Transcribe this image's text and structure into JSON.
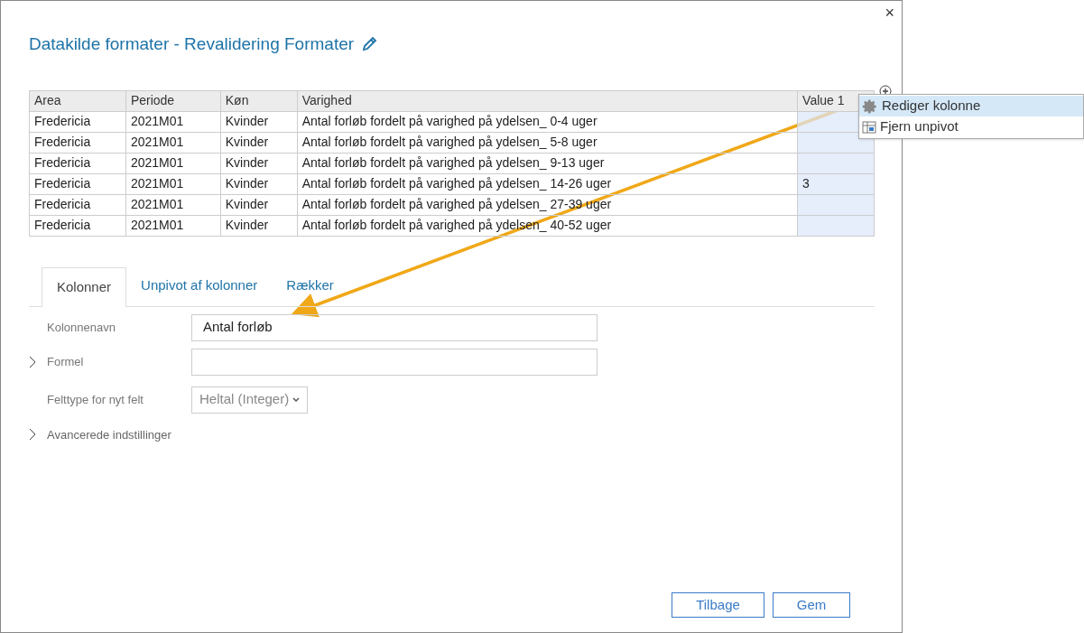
{
  "dialog": {
    "title": "Datakilde formater - Revalidering Formater",
    "close": "×"
  },
  "table": {
    "columns": [
      "Area",
      "Periode",
      "Køn",
      "Varighed",
      "Value 1"
    ],
    "rows": [
      [
        "Fredericia",
        "2021M01",
        "Kvinder",
        "Antal forløb fordelt på varighed på ydelsen_ 0-4 uger",
        ""
      ],
      [
        "Fredericia",
        "2021M01",
        "Kvinder",
        "Antal forløb fordelt på varighed på ydelsen_ 5-8 uger",
        ""
      ],
      [
        "Fredericia",
        "2021M01",
        "Kvinder",
        "Antal forløb fordelt på varighed på ydelsen_ 9-13 uger",
        ""
      ],
      [
        "Fredericia",
        "2021M01",
        "Kvinder",
        "Antal forløb fordelt på varighed på ydelsen_ 14-26 uger",
        "3"
      ],
      [
        "Fredericia",
        "2021M01",
        "Kvinder",
        "Antal forløb fordelt på varighed på ydelsen_ 27-39 uger",
        ""
      ],
      [
        "Fredericia",
        "2021M01",
        "Kvinder",
        "Antal forløb fordelt på varighed på ydelsen_ 40-52 uger",
        ""
      ]
    ]
  },
  "context_menu": {
    "items": [
      {
        "label": "Rediger kolonne",
        "kind": "gear",
        "selected": true
      },
      {
        "label": "Fjern unpivot",
        "kind": "unpivot",
        "selected": false
      }
    ]
  },
  "tabs": [
    {
      "label": "Kolonner",
      "selected": true
    },
    {
      "label": "Unpivot af kolonner",
      "selected": false
    },
    {
      "label": "Rækker",
      "selected": false
    }
  ],
  "form": {
    "fields": [
      {
        "kind": "text",
        "label": "Kolonnenavn",
        "value": "Antal forløb"
      },
      {
        "kind": "expandable_text",
        "label": "Formel",
        "expanded": false
      },
      {
        "kind": "select",
        "label": "Felttype for nyt felt",
        "value": "Heltal (Integer)"
      }
    ],
    "advanced": {
      "label": "Avancerede indstillinger",
      "expanded": false
    }
  },
  "buttons": [
    "Tilbage",
    "Gem"
  ]
}
